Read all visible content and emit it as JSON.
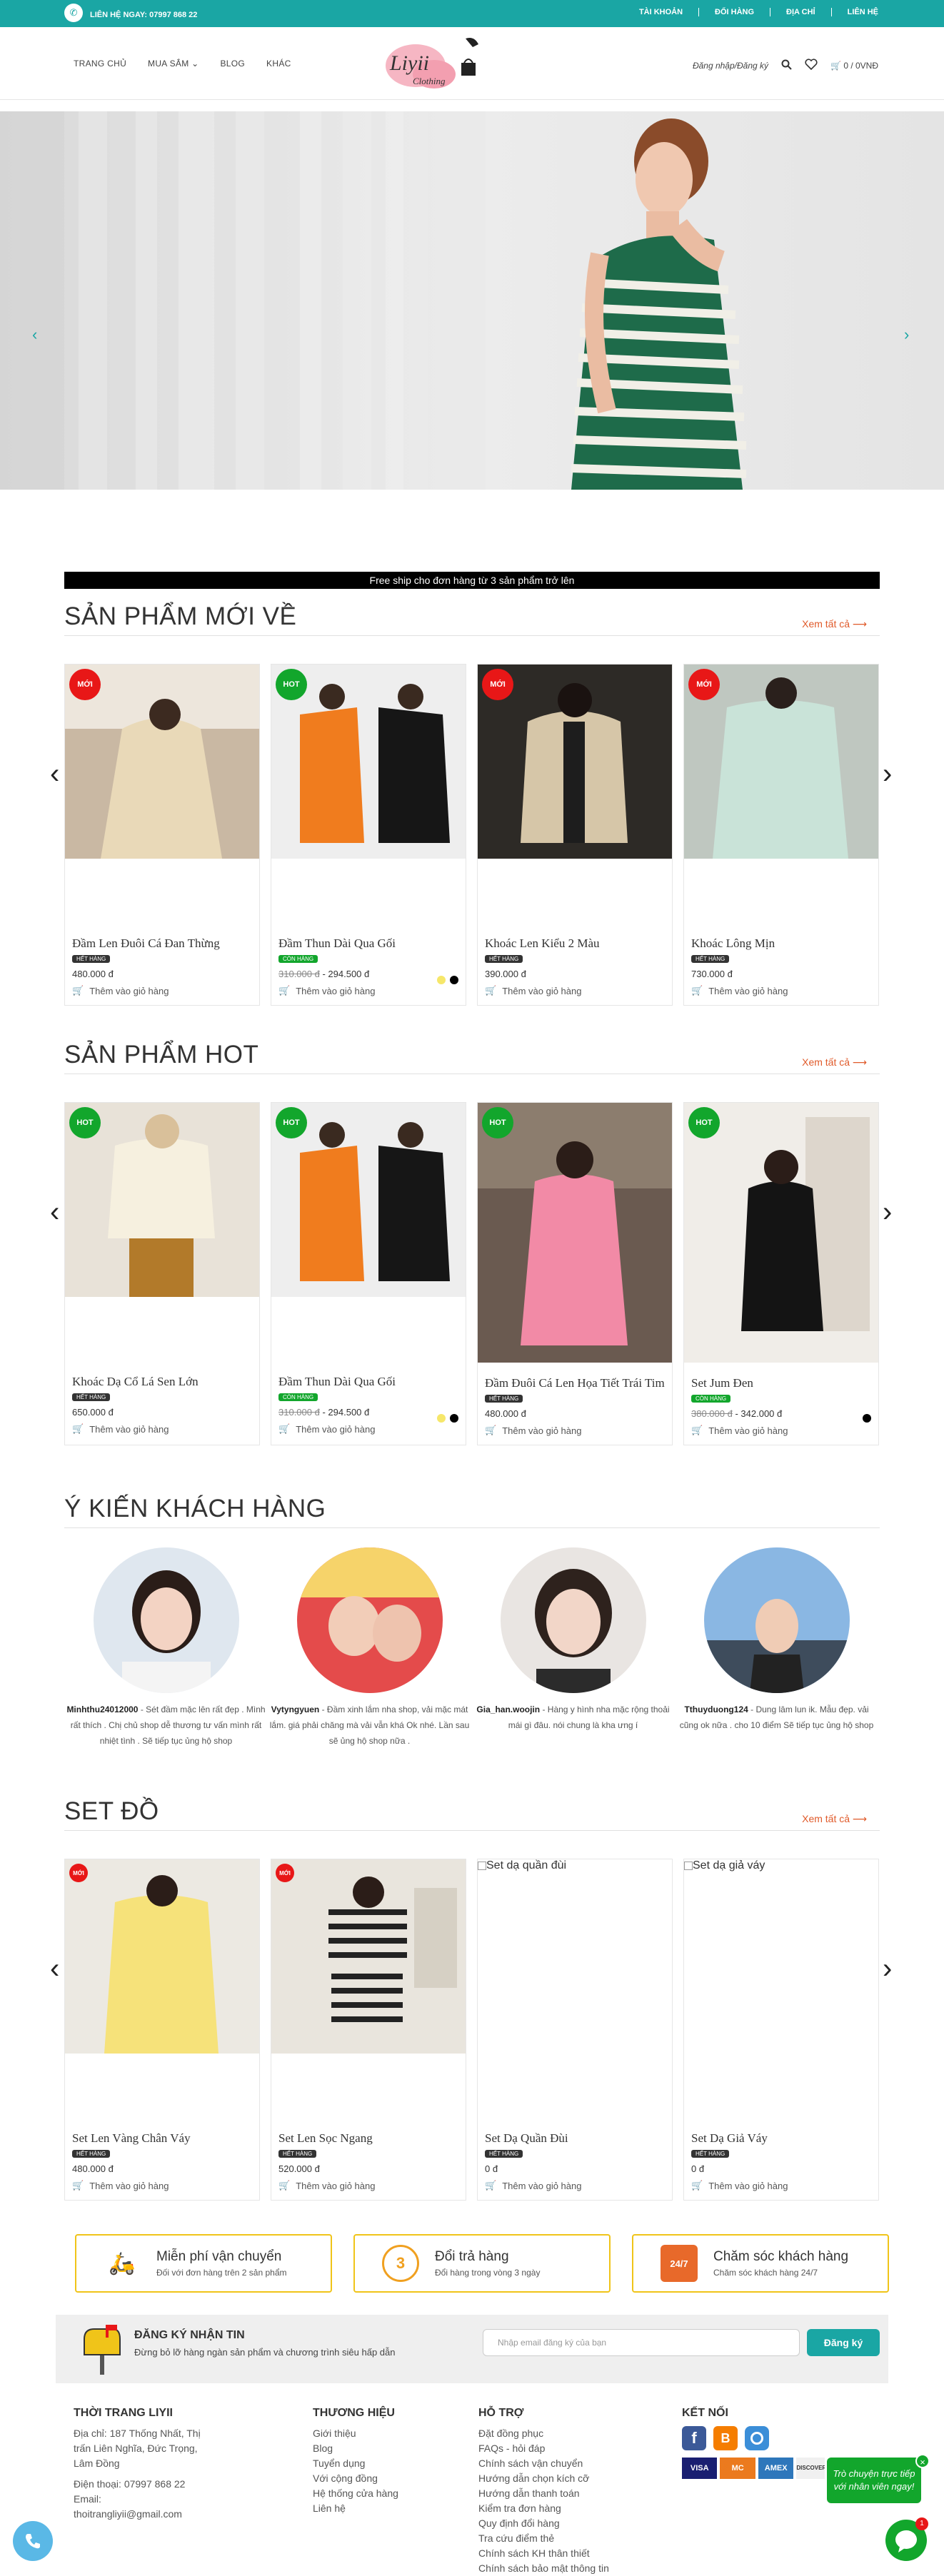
{
  "topbar": {
    "hotline": "LIÊN HỆ NGAY: 07997 868 22",
    "links": [
      "TÀI KHOẢN",
      "ĐỔI HÀNG",
      "ĐỊA CHỈ",
      "LIÊN HỆ"
    ]
  },
  "header": {
    "nav": [
      "TRANG CHỦ",
      "MUA SẮM",
      "BLOG",
      "KHÁC"
    ],
    "logo_text": "Liyii",
    "logo_sub": "Clothing",
    "login": "Đăng nhập/Đăng ký",
    "cart": "0 / 0VNĐ"
  },
  "shipping_banner": "Free ship cho đơn hàng từ 3 sản phẩm trở lên",
  "sections": {
    "new": {
      "title": "SẢN PHẨM MỚI VỀ",
      "see_all": "Xem tất cả",
      "products": [
        {
          "badge": "MỚI",
          "name": "Đầm Len Đuôi Cá Đan Thừng",
          "stock": "HẾT HÀNG",
          "price": "480.000 đ",
          "old_price": "",
          "cart": "Thêm vào giỏ hàng"
        },
        {
          "badge": "HOT",
          "name": "Đầm Thun Dài Qua Gối",
          "stock": "CÒN HÀNG",
          "price": "294.500 đ",
          "old_price": "310.000 đ",
          "cart": "Thêm vào giỏ hàng"
        },
        {
          "badge": "MỚI",
          "name": "Khoác Len Kiểu 2 Màu",
          "stock": "HẾT HÀNG",
          "price": "390.000 đ",
          "old_price": "",
          "cart": "Thêm vào giỏ hàng"
        },
        {
          "badge": "MỚI",
          "name": "Khoác Lông Mịn",
          "stock": "HẾT HÀNG",
          "price": "730.000 đ",
          "old_price": "",
          "cart": "Thêm vào giỏ hàng"
        }
      ]
    },
    "hot": {
      "title": "SẢN PHẨM HOT",
      "see_all": "Xem tất cả",
      "products": [
        {
          "badge": "HOT",
          "name": "Khoác Dạ Cổ Lá Sen Lớn",
          "stock": "HẾT HÀNG",
          "price": "650.000 đ",
          "old_price": "",
          "cart": "Thêm vào giỏ hàng"
        },
        {
          "badge": "HOT",
          "name": "Đầm Thun Dài Qua Gối",
          "stock": "CÒN HÀNG",
          "price": "294.500 đ",
          "old_price": "310.000 đ",
          "cart": "Thêm vào giỏ hàng"
        },
        {
          "badge": "HOT",
          "name": "Đầm Đuôi Cá Len Họa Tiết Trái Tim",
          "stock": "HẾT HÀNG",
          "price": "480.000 đ",
          "old_price": "",
          "cart": "Thêm vào giỏ hàng"
        },
        {
          "badge": "HOT",
          "name": "Set Jum Đen",
          "stock": "CÒN HÀNG",
          "price": "342.000 đ",
          "old_price": "380.000 đ",
          "cart": "Thêm vào giỏ hàng"
        }
      ]
    },
    "reviews": {
      "title": "Ý KIẾN KHÁCH HÀNG",
      "items": [
        {
          "user": "Minhthu24012000",
          "text": " - Sét đầm mặc lên rất đẹp . Mình rất thích . Chị chủ shop dễ thương tư vấn mình rất nhiệt tình . Sẽ tiếp tục ủng hộ shop"
        },
        {
          "user": "Vytyngyuen",
          "text": " - Đầm xinh lắm nha shop, vải mặc mát lắm. giá phải chăng mà vải vẫn khá Ok nhé. Lần sau sẽ ủng hộ shop nữa ."
        },
        {
          "user": "Gia_han.woojin",
          "text": " - Hàng y hình nha mặc rộng thoải mái gì đâu. nói chung là kha ưng í"
        },
        {
          "user": "Tthuyduong124",
          "text": " - Dung lâm lun ik. Mẫu đẹp. vải cũng ok nữa . cho 10 điểm Sẽ tiếp tục ủng hộ shop"
        }
      ]
    },
    "sets": {
      "title": "SET ĐỒ",
      "see_all": "Xem tất cả",
      "products": [
        {
          "badge": "MỚI",
          "name": "Set Len Vàng Chân Váy",
          "stock": "HẾT HÀNG",
          "price": "480.000 đ",
          "old_price": "",
          "cart": "Thêm vào giỏ hàng",
          "img_alt": ""
        },
        {
          "badge": "MỚI",
          "name": "Set Len Sọc Ngang",
          "stock": "HẾT HÀNG",
          "price": "520.000 đ",
          "old_price": "",
          "cart": "Thêm vào giỏ hàng",
          "img_alt": ""
        },
        {
          "badge": "",
          "name": "Set Dạ Quần Đùi",
          "stock": "HẾT HÀNG",
          "price": "0 đ",
          "old_price": "",
          "cart": "Thêm vào giỏ hàng",
          "img_alt": "Set dạ quần đùi"
        },
        {
          "badge": "",
          "name": "Set Dạ Giả Váy",
          "stock": "HẾT HÀNG",
          "price": "0 đ",
          "old_price": "",
          "cart": "Thêm vào giỏ hàng",
          "img_alt": "Set dạ giả váy"
        }
      ]
    }
  },
  "features": [
    {
      "title": "Miễn phí vận chuyển",
      "desc": "Đối với đơn hàng trên 2 sản phẩm",
      "color": "#f5a15a"
    },
    {
      "title": "Đổi trả hàng",
      "desc": "Đổi hàng trong vòng 3 ngày",
      "color": "#f0a020"
    },
    {
      "title": "Chăm sóc khách hàng",
      "desc": "Chăm sóc khách hàng 24/7",
      "color": "#e8692a"
    }
  ],
  "newsletter": {
    "title": "ĐĂNG KÝ NHẬN TIN",
    "subtitle": "Đừng bỏ lỡ hàng ngàn sản phẩm và chương trình siêu hấp dẫn",
    "placeholder": "Nhập email đăng ký của bạn",
    "button": "Đăng ký"
  },
  "footer": {
    "col1": {
      "title": "THỜI TRANG LIYII",
      "address": "Địa chỉ: 187 Thống Nhất, Thị trấn Liên Nghĩa, Đức Trọng, Lâm Đồng",
      "phone": "Điện thoại: 07997 868 22",
      "email_label": "Email:",
      "email": "thoitrangliyii@gmail.com"
    },
    "col2": {
      "title": "THƯƠNG HIỆU",
      "links": [
        "Giới thiệu",
        "Blog",
        "Tuyển dụng",
        "Với cộng đồng",
        "Hệ thống cửa hàng",
        "Liên hệ"
      ]
    },
    "col3": {
      "title": "HỖ TRỢ",
      "links": [
        "Đặt đồng phục",
        "FAQs - hỏi đáp",
        "Chính sách vận chuyển",
        "Hướng dẫn chọn kích cỡ",
        "Hướng dẫn thanh toán",
        "Kiểm tra đơn hàng",
        "Quy định đổi hàng",
        "Tra cứu điểm thẻ",
        "Chính sách KH thân thiết",
        "Chính sách bảo mật thông tin"
      ]
    },
    "col4": {
      "title": "KẾT NỐI",
      "cards": [
        "VISA",
        "MC",
        "AMEX",
        "DISCOVER"
      ]
    }
  },
  "chat": {
    "text": "Trò chuyện trực tiếp với nhân viên ngay!",
    "count": "1"
  }
}
